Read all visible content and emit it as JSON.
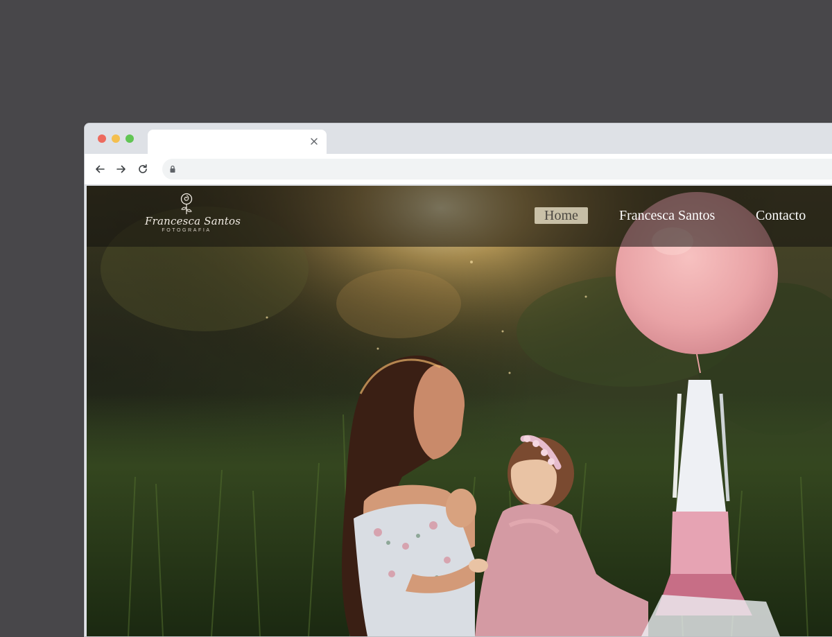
{
  "browser": {
    "tab": {
      "title": "",
      "close_icon": "close-icon"
    },
    "toolbar": {
      "back_icon": "arrow-left-icon",
      "forward_icon": "arrow-right-icon",
      "reload_icon": "reload-icon",
      "lock_icon": "lock-icon",
      "url": ""
    },
    "traffic_lights": {
      "close_color": "#ed6a5e",
      "minimize_color": "#f4bf4f",
      "maximize_color": "#61c554"
    }
  },
  "site": {
    "logo": {
      "icon": "rose-icon",
      "name": "Francesca Santos",
      "subtitle": "FOTOGRAFIA"
    },
    "nav": {
      "items": [
        {
          "label": "Home",
          "active": true
        },
        {
          "label": "Francesca Santos",
          "active": false
        },
        {
          "label": "Contacto",
          "active": false
        }
      ]
    },
    "hero": {
      "image": "mother-and-baby-in-meadow-with-pink-balloon-photo"
    }
  }
}
